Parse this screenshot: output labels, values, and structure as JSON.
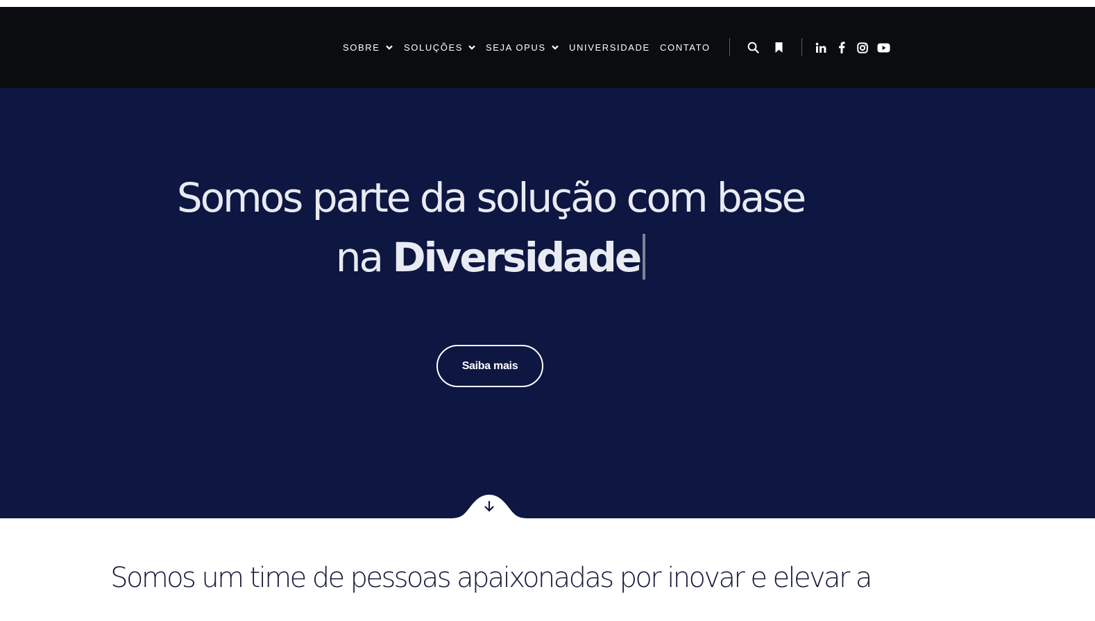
{
  "nav": {
    "items": [
      {
        "label": "SOBRE",
        "has_dropdown": true
      },
      {
        "label": "SOLUÇÕES",
        "has_dropdown": true
      },
      {
        "label": "SEJA OPUS",
        "has_dropdown": true
      },
      {
        "label": "UNIVERSIDADE",
        "has_dropdown": false
      },
      {
        "label": "CONTATO",
        "has_dropdown": false
      }
    ],
    "utility_icons": [
      "search-icon",
      "bookmark-icon"
    ],
    "social_icons": [
      "linkedin-icon",
      "facebook-icon",
      "instagram-icon",
      "youtube-icon"
    ]
  },
  "hero": {
    "title_line1": "Somos parte da solução com base",
    "title_line2_prefix": "na",
    "title_highlight": "Diversidade",
    "cta_label": "Saiba mais"
  },
  "intro": {
    "text": "Somos um time de pessoas apaixonadas por inovar e elevar a"
  },
  "colors": {
    "navbar_bg": "#0b0c10",
    "hero_bg": "#0e1742",
    "page_bg": "#ffffff",
    "text_light": "#e9ebf3",
    "text_dark": "#15193a"
  }
}
